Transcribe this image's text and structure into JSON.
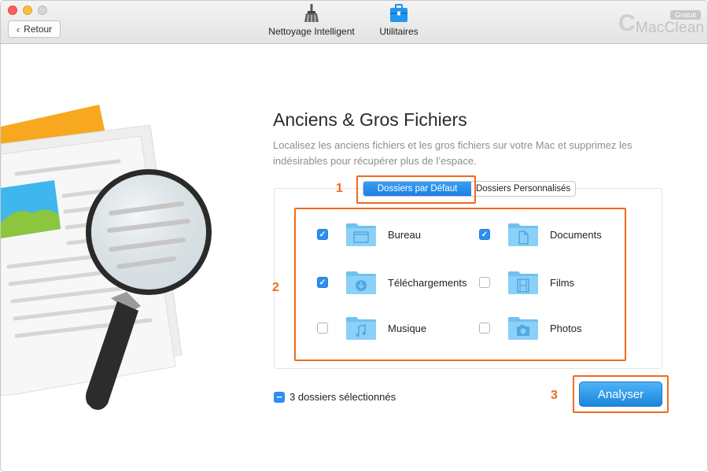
{
  "toolbar": {
    "back_label": "Retour",
    "nav": [
      {
        "label": "Nettoyage Intelligent",
        "icon": "broom-icon"
      },
      {
        "label": "Utilitaires",
        "icon": "toolbox-icon"
      }
    ],
    "brand_badge": "Gratuit",
    "brand_c": "C",
    "brand_name": "MacClean"
  },
  "main": {
    "title": "Anciens & Gros Fichiers",
    "description": "Localisez les anciens fichiers et les gros fichiers sur votre Mac et supprimez les indésirables pour récupérer plus de l’espace.",
    "tabs": [
      {
        "label": "Dossiers par Défaut",
        "active": true
      },
      {
        "label": "Dossiers Personnalisés",
        "active": false
      }
    ],
    "folders": [
      {
        "label": "Bureau",
        "checked": true,
        "icon": "desktop-folder-icon"
      },
      {
        "label": "Documents",
        "checked": true,
        "icon": "documents-folder-icon"
      },
      {
        "label": "Téléchargements",
        "checked": true,
        "icon": "downloads-folder-icon"
      },
      {
        "label": "Films",
        "checked": false,
        "icon": "movies-folder-icon"
      },
      {
        "label": "Musique",
        "checked": false,
        "icon": "music-folder-icon"
      },
      {
        "label": "Photos",
        "checked": false,
        "icon": "pictures-folder-icon"
      }
    ],
    "selection_status": "3 dossiers sélectionnés",
    "analyse_label": "Analyser"
  },
  "annotations": [
    "1",
    "2",
    "3"
  ],
  "colors": {
    "accent": "#2d8ff0",
    "annotation": "#f26a1b",
    "folder": "#6ec1f3"
  }
}
